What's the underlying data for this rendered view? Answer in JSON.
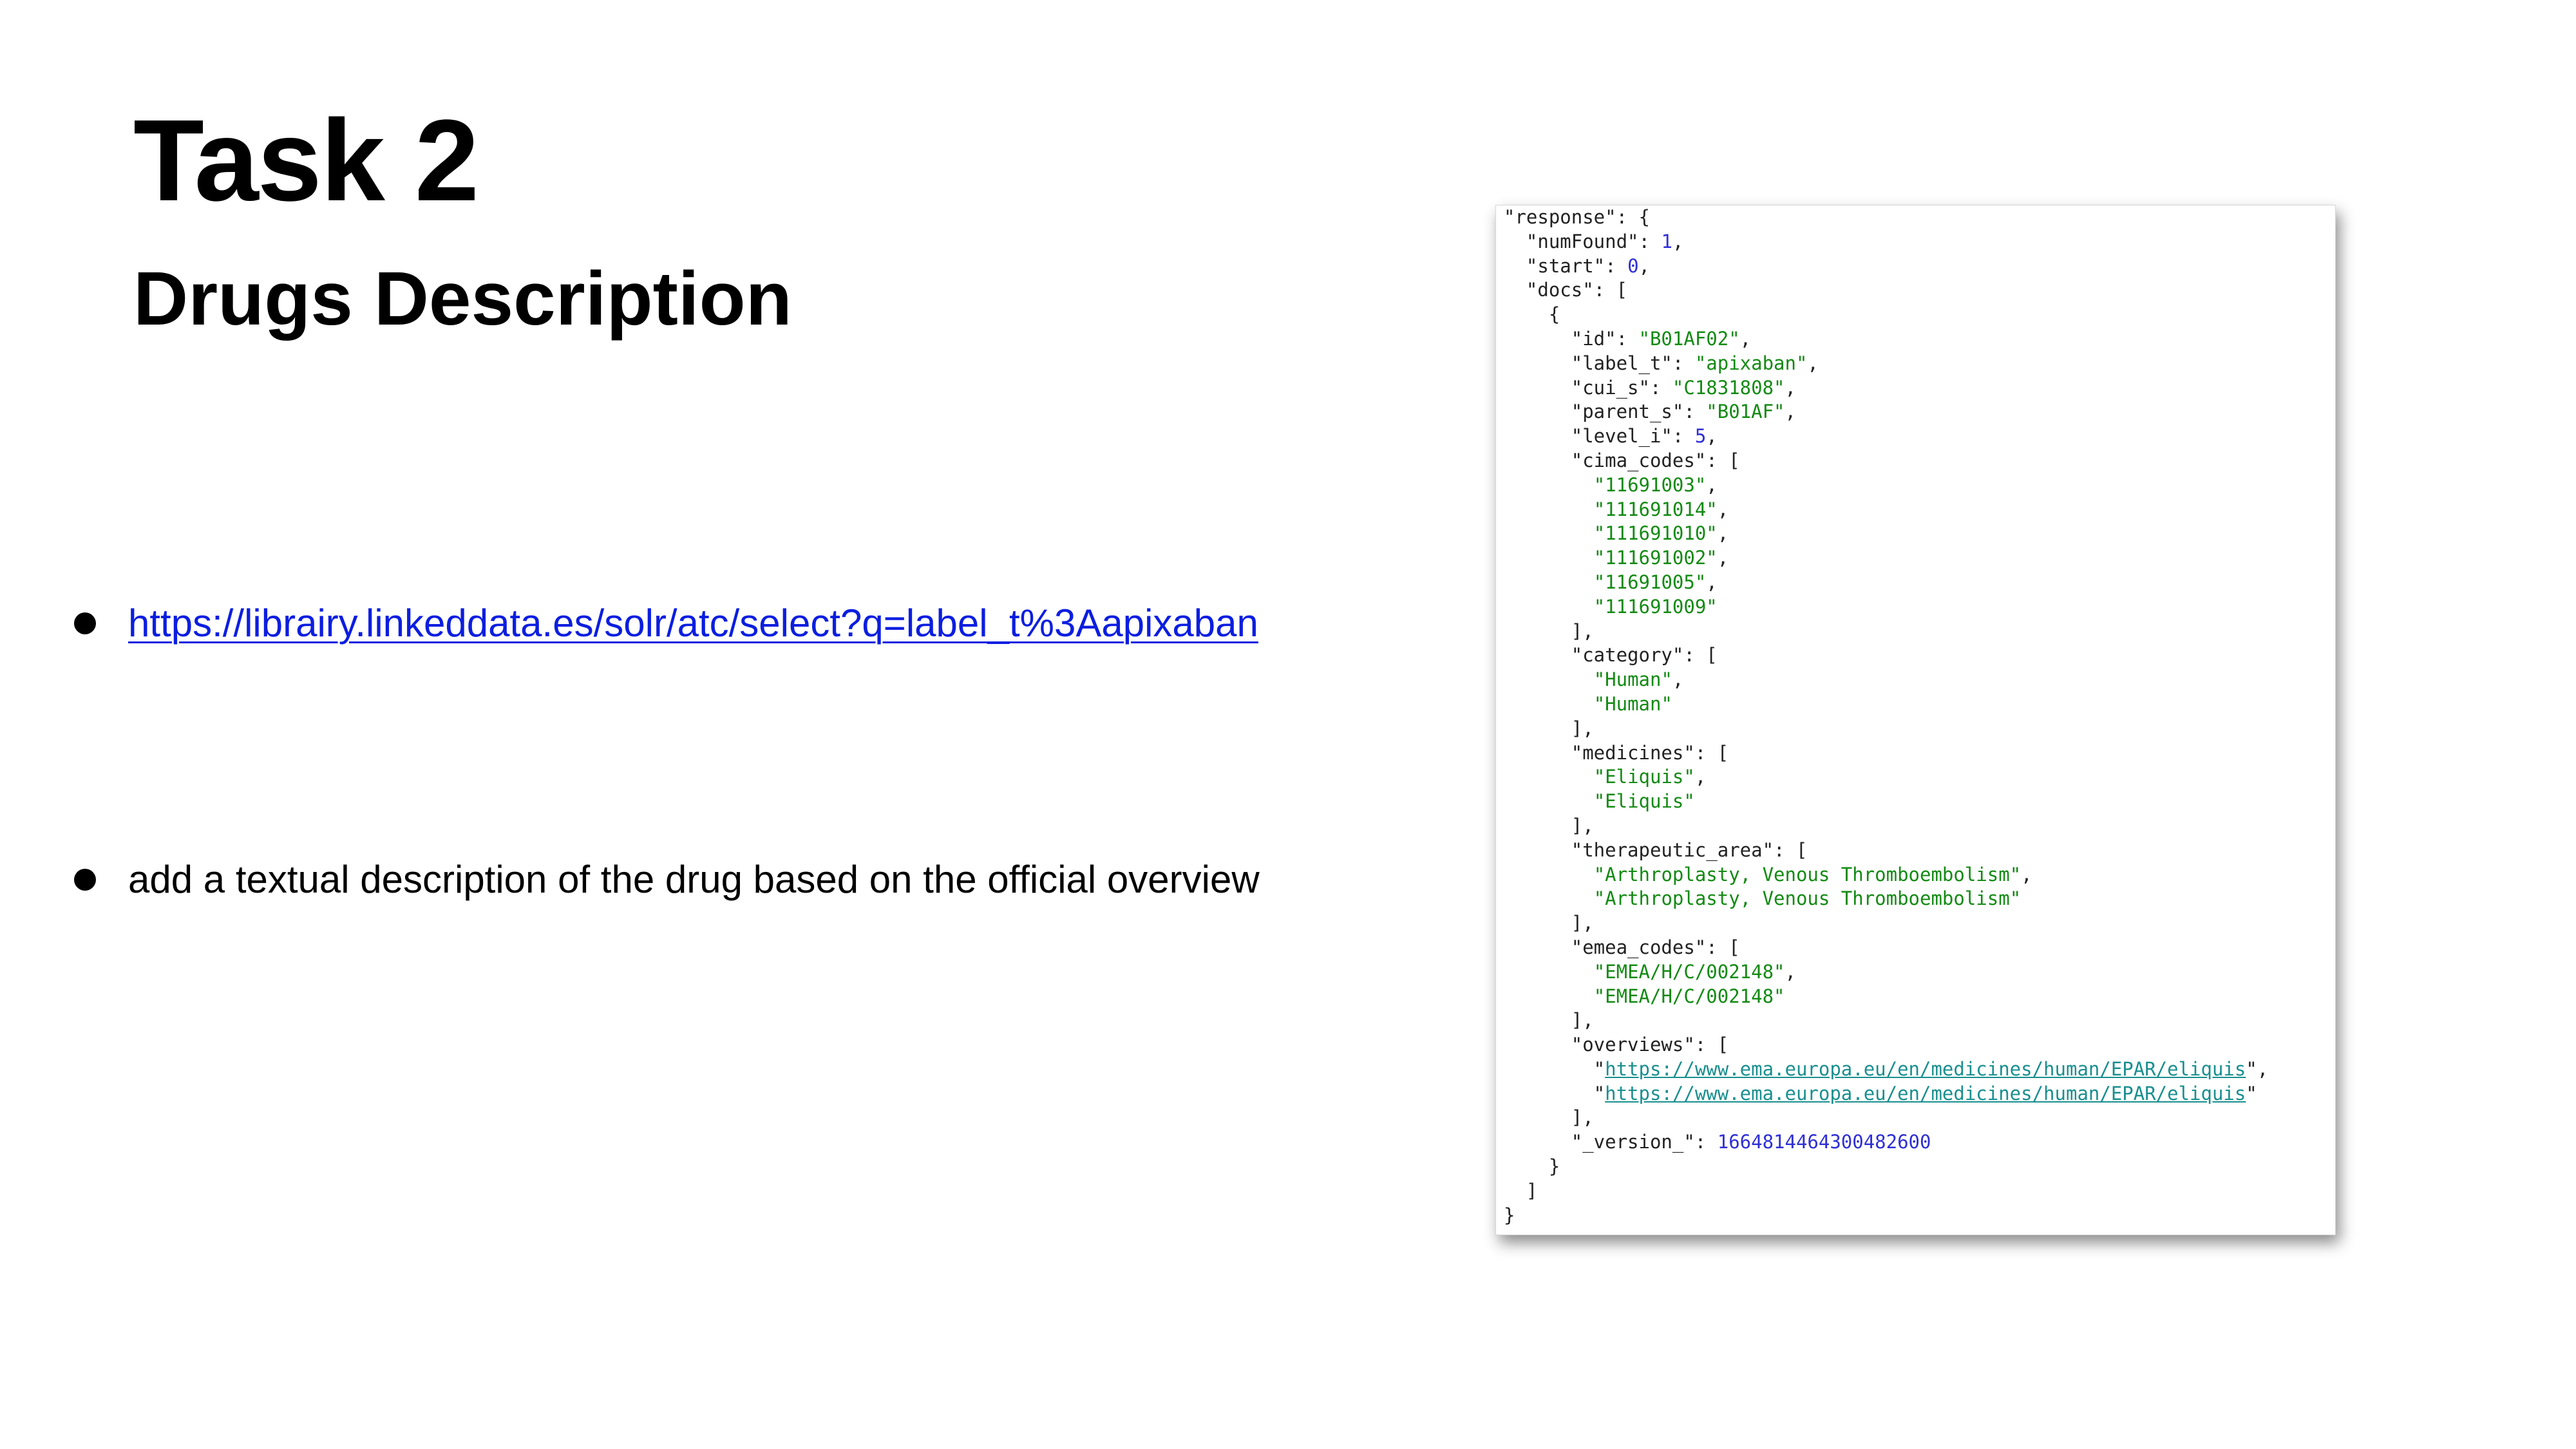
{
  "slide": {
    "title": "Task 2",
    "subtitle": "Drugs Description",
    "bullets": [
      {
        "text": "https://librairy.linkeddata.es/solr/atc/select?q=label_t%3Aapixaban",
        "is_link": true
      },
      {
        "text": "add a textual description of the drug based on the official overview",
        "is_link": false
      }
    ]
  },
  "colors": {
    "link": "#0b1ee0",
    "json_string": "#138a13",
    "json_number": "#2f2fd6",
    "json_url": "#1a8f8f"
  },
  "json_response": {
    "numFound": "1",
    "start": "0",
    "id": "\"B01AF02\"",
    "label_t": "\"apixaban\"",
    "cui_s": "\"C1831808\"",
    "parent_s": "\"B01AF\"",
    "level_i": "5",
    "cima_codes": [
      "\"11691003\"",
      "\"111691014\"",
      "\"111691010\"",
      "\"111691002\"",
      "\"11691005\"",
      "\"111691009\""
    ],
    "category": [
      "\"Human\"",
      "\"Human\""
    ],
    "medicines": [
      "\"Eliquis\"",
      "\"Eliquis\""
    ],
    "therapeutic_area": [
      "\"Arthroplasty, Venous Thromboembolism\"",
      "\"Arthroplasty, Venous Thromboembolism\""
    ],
    "emea_codes": [
      "\"EMEA/H/C/002148\"",
      "\"EMEA/H/C/002148\""
    ],
    "overviews": [
      "https://www.ema.europa.eu/en/medicines/human/EPAR/eliquis",
      "https://www.ema.europa.eu/en/medicines/human/EPAR/eliquis"
    ],
    "_version_": "1664814464300482600"
  }
}
